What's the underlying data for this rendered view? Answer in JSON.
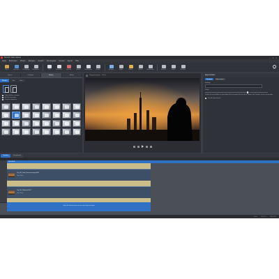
{
  "window": {
    "title": "MAGIX Video deluxe",
    "controls": [
      "–",
      "□",
      "×"
    ]
  },
  "menu": [
    "Datei",
    "Bearbeiten",
    "Effekte",
    "Einfügen",
    "Ansicht",
    "Wiedergabe",
    "Fenster",
    "Export",
    "Hilfe"
  ],
  "toolbar": {
    "items": [
      {
        "label": "Öffnen",
        "icon": "folder-icon",
        "color": "#c9a451"
      },
      {
        "label": "Speichern",
        "icon": "save-icon",
        "color": "#5c8fd6"
      },
      {
        "label": "Rückgängig",
        "icon": "undo-icon",
        "color": "#b8bcc3"
      },
      {
        "label": "Wiederherst.",
        "icon": "redo-icon",
        "color": "#b8bcc3"
      },
      {
        "label": "Titel",
        "icon": "title-icon",
        "color": "#d9dde2"
      },
      {
        "label": "Schneiden",
        "icon": "cut-icon",
        "color": "#d9dde2"
      },
      {
        "label": "Löschen",
        "icon": "delete-icon",
        "color": "#d46a6a"
      },
      {
        "label": "Marker",
        "icon": "marker-icon",
        "color": "#b8bcc3"
      },
      {
        "label": "Wiedergabe",
        "icon": "play-icon",
        "color": "#d9dde2"
      },
      {
        "label": "Modus",
        "icon": "mode-icon",
        "color": "#b8bcc3"
      },
      {
        "label": "Einfügen",
        "icon": "insert-icon",
        "color": "#7fb0e8"
      },
      {
        "label": "Gruppe",
        "icon": "group-icon",
        "color": "#b8bcc3"
      },
      {
        "label": "Effekte",
        "icon": "effects-icon",
        "color": "#e2b24a"
      },
      {
        "label": "Blende",
        "icon": "fade-icon",
        "color": "#b8bcc3"
      },
      {
        "label": "Ausblenden",
        "icon": "hide-icon",
        "color": "#b8bcc3"
      },
      {
        "label": "Speicher",
        "icon": "disk-icon",
        "color": "#b8bcc3"
      },
      {
        "label": "Export",
        "icon": "export-icon",
        "color": "#b8bcc3"
      },
      {
        "label": "Brennen",
        "icon": "burn-icon",
        "color": "#b8bcc3"
      }
    ],
    "right_label": "Hilfe"
  },
  "media_pool": {
    "tabs": [
      "Import",
      "Vorlagen",
      "Effekte",
      "Audio"
    ],
    "subtabs": [
      "Blenden",
      "Titel",
      "Deko"
    ],
    "options": [
      "Objekt-Effekte anzeigen",
      "Auf Clip anwenden",
      "Vorschau abspielen"
    ]
  },
  "preview": {
    "header_label": "Programmmonitor",
    "zoom": "100 %"
  },
  "properties": {
    "header": "Eigenschaften",
    "buttons": [
      "Standard",
      "Übernehmen"
    ],
    "label1": "Effekttyp",
    "label2": "Stärke",
    "text": "Wählen Sie einen Effekt aus dem Media Pool und ziehen Sie ihn auf ein Objekt in der Timeline, um ihn anzuwenden.",
    "checkbox": "Für alle übernehmen"
  },
  "timeline": {
    "tabs": [
      "Timeline",
      "Storyboard"
    ],
    "ruler_label": "00:00:00:00",
    "clips": [
      {
        "name": "Clip_001_Stadt_Sonnenuntergang.MOV",
        "sub": "Video / Audio"
      },
      {
        "name": "Clip_002_Silhouette.MOV",
        "sub": "Video / Audio"
      }
    ],
    "drop_text": "Ziehen Sie Dateien hierher, um sie in das Projekt einzufügen"
  },
  "status": [
    "Bereit",
    "CPU: 12 %",
    "00:01:24:12"
  ]
}
